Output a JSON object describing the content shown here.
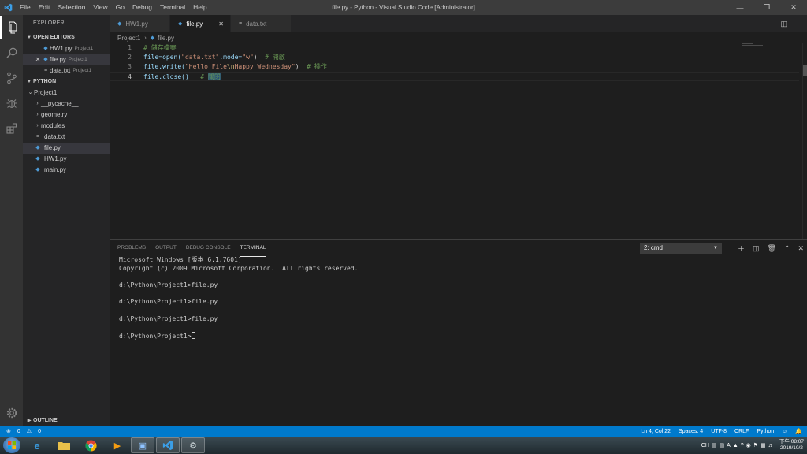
{
  "window": {
    "title": "file.py - Python - Visual Studio Code [Administrator]",
    "menu": [
      "File",
      "Edit",
      "Selection",
      "View",
      "Go",
      "Debug",
      "Terminal",
      "Help"
    ]
  },
  "sidebar": {
    "header": "EXPLORER",
    "open_editors_label": "OPEN EDITORS",
    "open_editors": [
      {
        "name": "HW1.py",
        "desc": "Project1"
      },
      {
        "name": "file.py",
        "desc": "Project1"
      },
      {
        "name": "data.txt",
        "desc": "Project1"
      }
    ],
    "workspace_label": "PYTHON",
    "project": "Project1",
    "tree": [
      "__pycache__",
      "geometry",
      "modules",
      "data.txt",
      "file.py",
      "HW1.py",
      "main.py"
    ],
    "outline_label": "OUTLINE"
  },
  "tabs": [
    {
      "label": "HW1.py"
    },
    {
      "label": "file.py"
    },
    {
      "label": "data.txt"
    }
  ],
  "breadcrumb": {
    "folder": "Project1",
    "file": "file.py"
  },
  "code": {
    "line_numbers": [
      "1",
      "2",
      "3",
      "4"
    ],
    "l1_comment": "# 儲存檔案",
    "l2_a": "file=open(",
    "l2_str1": "\"data.txt\"",
    "l2_b": ",mode=",
    "l2_str2": "\"w\"",
    "l2_c": ")  ",
    "l2_comment": "# 開啟",
    "l3_a": "file.write(",
    "l3_str1": "\"Hello File",
    "l3_esc": "\\n",
    "l3_str2": "Happy Wednesday\"",
    "l3_c": ")  ",
    "l3_comment": "# 操作",
    "l4_a": "file.close()   ",
    "l4_comment_a": "# ",
    "l4_comment_sel": "關閉"
  },
  "panel": {
    "tabs": [
      "PROBLEMS",
      "OUTPUT",
      "DEBUG CONSOLE",
      "TERMINAL"
    ],
    "terminal_select": "2: cmd",
    "terminal_lines": [
      "Microsoft Windows [版本 6.1.7601]",
      "Copyright (c) 2009 Microsoft Corporation.  All rights reserved.",
      "",
      "d:\\Python\\Project1>file.py",
      "",
      "d:\\Python\\Project1>file.py",
      "",
      "d:\\Python\\Project1>file.py",
      ""
    ],
    "prompt": "d:\\Python\\Project1>"
  },
  "statusbar": {
    "errors": "0",
    "warnings": "0",
    "position": "Ln 4, Col 22",
    "spaces": "Spaces: 4",
    "encoding": "UTF-8",
    "eol": "CRLF",
    "language": "Python"
  },
  "taskbar": {
    "ime": "CH",
    "time": "下午 08:07",
    "date": "2019/10/2"
  },
  "colors": {
    "statusbar": "#007acc",
    "activitybar": "#333333",
    "sidebar": "#252526",
    "editor": "#1e1e1e",
    "comment": "#6a9955",
    "string": "#ce9178"
  },
  "icons": [
    "vscode-logo-icon",
    "files-icon",
    "search-icon",
    "source-control-icon",
    "debug-icon",
    "extensions-icon",
    "settings-gear-icon",
    "python-file-icon",
    "text-file-icon",
    "split-editor-icon",
    "more-icon"
  ]
}
